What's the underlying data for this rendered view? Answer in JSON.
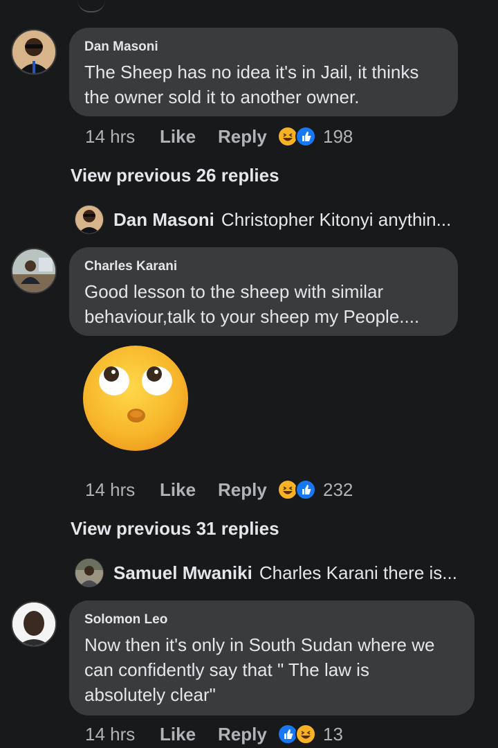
{
  "comments": [
    {
      "author": "Dan Masoni",
      "lines": [
        "The Sheep has no idea it's in Jail, it thinks",
        "the owner sold it to another owner."
      ],
      "time": "14 hrs",
      "like_label": "Like",
      "reply_label": "Reply",
      "reaction_count": "198",
      "reactions": [
        "haha-icon",
        "like-icon"
      ]
    },
    {
      "author": "Charles Karani",
      "lines": [
        "Good lesson to the sheep with similar",
        "behaviour,talk to your sheep my People...."
      ],
      "time": "14 hrs",
      "like_label": "Like",
      "reply_label": "Reply",
      "reaction_count": "232",
      "reactions": [
        "haha-icon",
        "like-icon"
      ],
      "sticker": "face-with-rolling-eyes-emoji"
    },
    {
      "author": "Solomon Leo",
      "lines": [
        "Now then it's only in South Sudan where we",
        "can confidently say that \" The law is",
        "absolutely clear\""
      ],
      "time": "14 hrs",
      "like_label": "Like",
      "reply_label": "Reply",
      "reaction_count": "13",
      "reactions": [
        "like-icon",
        "haha-icon"
      ]
    }
  ],
  "threads": [
    {
      "view_previous": "View previous 26 replies",
      "reply_author": "Dan Masoni",
      "reply_preview": "Christopher Kitonyi anythin..."
    },
    {
      "view_previous": "View previous 31 replies",
      "reply_author": "Samuel Mwaniki",
      "reply_preview": "Charles Karani there is..."
    }
  ],
  "colors": {
    "background": "#18191a",
    "bubble": "#3a3b3c",
    "primary_text": "#e4e6eb",
    "secondary_text": "#b0b3b8",
    "like_blue": "#1877f2",
    "haha_yellow": "#f7b125"
  }
}
